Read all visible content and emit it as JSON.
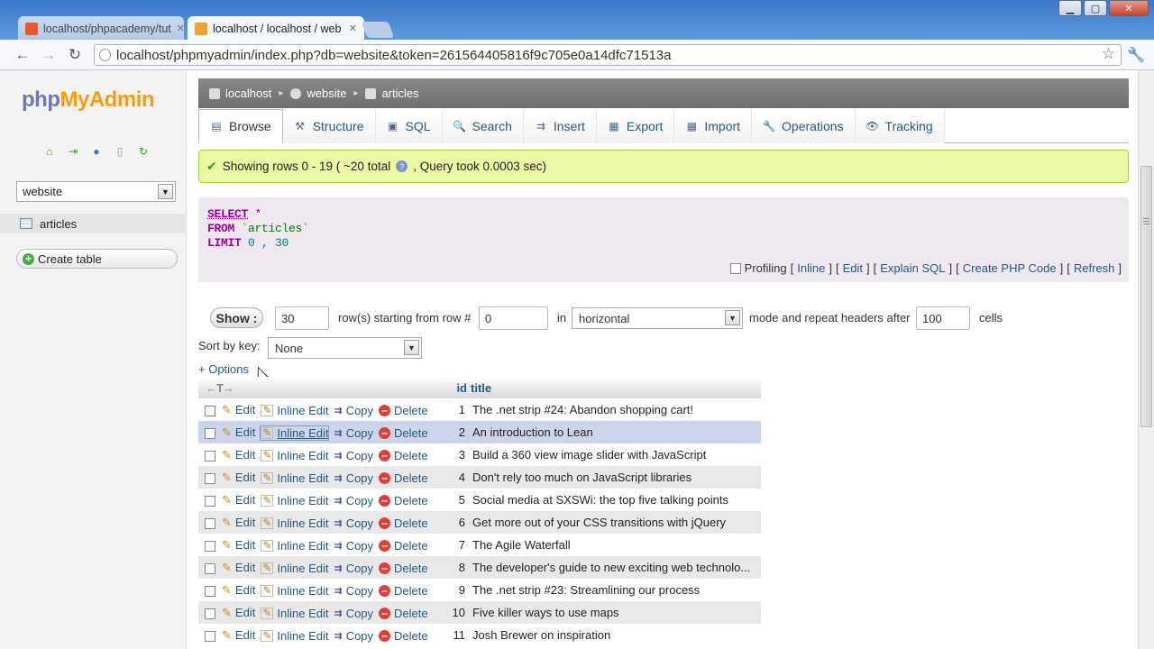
{
  "browser": {
    "tabs": [
      {
        "title": "localhost/phpacademy/tut",
        "active": false
      },
      {
        "title": "localhost / localhost / web",
        "active": true
      }
    ],
    "url": "localhost/phpmyadmin/index.php?db=website&token=261564405816f9c705e0a14dfc71513a"
  },
  "sidebar": {
    "logo_php": "php",
    "logo_my": "My",
    "logo_admin": "Admin",
    "database_select": "website",
    "tables": [
      {
        "label": "articles"
      }
    ],
    "create_table": "Create table"
  },
  "breadcrumb": [
    "localhost",
    "website",
    "articles"
  ],
  "tabs": [
    {
      "label": "Browse",
      "icon": "browse-icon"
    },
    {
      "label": "Structure",
      "icon": "structure-icon"
    },
    {
      "label": "SQL",
      "icon": "sql-icon"
    },
    {
      "label": "Search",
      "icon": "search-icon"
    },
    {
      "label": "Insert",
      "icon": "insert-icon"
    },
    {
      "label": "Export",
      "icon": "export-icon"
    },
    {
      "label": "Import",
      "icon": "import-icon"
    },
    {
      "label": "Operations",
      "icon": "operations-icon"
    },
    {
      "label": "Tracking",
      "icon": "tracking-icon"
    }
  ],
  "notice": {
    "text_before": "Showing rows 0 - 19 ( ~20 total",
    "text_after": ", Query took 0.0003 sec)"
  },
  "sql": {
    "select": "SELECT",
    "star": "*",
    "from": "FROM",
    "table": "`articles`",
    "limit": "LIMIT",
    "limit_values": "0 , 30"
  },
  "sql_links": {
    "profiling": "Profiling",
    "inline": "Inline",
    "edit": "Edit",
    "explain": "Explain SQL",
    "php_code": "Create PHP Code",
    "refresh": "Refresh"
  },
  "show_controls": {
    "button": "Show :",
    "rows": "30",
    "starting_label": "row(s) starting from row #",
    "start_row": "0",
    "in_label": "in",
    "mode": "horizontal",
    "mode_label": "mode and repeat headers after",
    "repeat": "100",
    "cells_label": "cells"
  },
  "sort": {
    "label": "Sort by key:",
    "value": "None"
  },
  "options_link": "+ Options",
  "table": {
    "columns": [
      "id",
      "title"
    ],
    "action_labels": {
      "edit": "Edit",
      "inline_edit": "Inline Edit",
      "copy": "Copy",
      "delete": "Delete"
    },
    "rows": [
      {
        "id": "1",
        "title": "The .net strip #24: Abandon shopping cart!"
      },
      {
        "id": "2",
        "title": "An introduction to Lean"
      },
      {
        "id": "3",
        "title": "Build a 360 view image slider with JavaScript"
      },
      {
        "id": "4",
        "title": "Don't rely too much on JavaScript libraries"
      },
      {
        "id": "5",
        "title": "Social media at SXSWi: the top five talking points"
      },
      {
        "id": "6",
        "title": "Get more out of your CSS transitions with jQuery"
      },
      {
        "id": "7",
        "title": "The Agile Waterfall"
      },
      {
        "id": "8",
        "title": "The developer's guide to new exciting web technolo..."
      },
      {
        "id": "9",
        "title": "The .net strip #23: Streamlining our process"
      },
      {
        "id": "10",
        "title": "Five killer ways to use maps"
      },
      {
        "id": "11",
        "title": "Josh Brewer on inspiration"
      }
    ]
  }
}
